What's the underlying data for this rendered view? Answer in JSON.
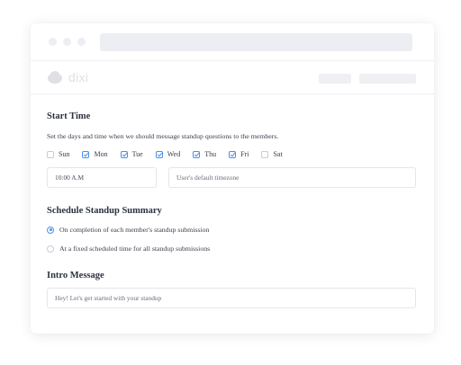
{
  "brand": {
    "name": "dixi"
  },
  "start_time": {
    "title": "Start Time",
    "description": "Set the days and time when we should message standup questions to the members.",
    "days": [
      {
        "label": "Sun",
        "checked": false
      },
      {
        "label": "Mon",
        "checked": true
      },
      {
        "label": "Tue",
        "checked": true
      },
      {
        "label": "Wed",
        "checked": true
      },
      {
        "label": "Thu",
        "checked": true
      },
      {
        "label": "Fri",
        "checked": true
      },
      {
        "label": "Sat",
        "checked": false
      }
    ],
    "time_value": "10:00 A.M",
    "timezone_placeholder": "User's default timezone"
  },
  "summary": {
    "title": "Schedule Standup Summary",
    "options": [
      {
        "label": "On completion of each member's standup submission",
        "selected": true
      },
      {
        "label": "At a fixed scheduled time for all standup submissions",
        "selected": false
      }
    ]
  },
  "intro": {
    "title": "Intro Message",
    "placeholder": "Hey! Let's get started with your standup"
  },
  "colors": {
    "accent": "#4a8fea",
    "placeholder": "#eef0f4"
  }
}
